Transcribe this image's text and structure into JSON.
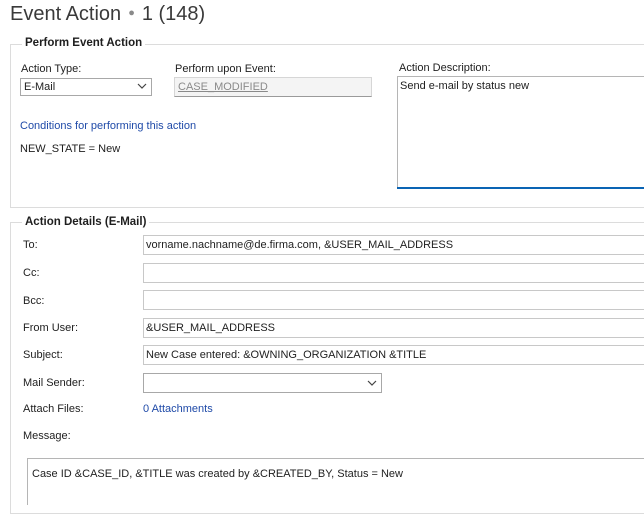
{
  "header": {
    "title": "Event Action",
    "record_id": "1 (148)"
  },
  "perform_group": {
    "legend": "Perform Event Action",
    "action_type_label": "Action Type:",
    "action_type_value": "E-Mail",
    "perform_upon_label": "Perform upon Event:",
    "perform_upon_value": "CASE_MODIFIED",
    "conditions_link": "Conditions for performing this action",
    "condition_text": "NEW_STATE = New",
    "description_label": "Action Description:",
    "description_value": "Send e-mail by status new"
  },
  "details_group": {
    "legend": "Action Details (E-Mail)",
    "to_label": "To:",
    "to_value": "vorname.nachname@de.firma.com, &USER_MAIL_ADDRESS",
    "cc_label": "Cc:",
    "cc_value": "",
    "bcc_label": "Bcc:",
    "bcc_value": "",
    "from_label": "From User:",
    "from_value": "&USER_MAIL_ADDRESS",
    "subject_label": "Subject:",
    "subject_value": "New Case entered: &OWNING_ORGANIZATION &TITLE",
    "sender_label": "Mail Sender:",
    "sender_value": "",
    "attach_label": "Attach Files:",
    "attach_link": "0 Attachments",
    "message_label": "Message:",
    "message_value": "Case ID &CASE_ID, &TITLE was created by &CREATED_BY, Status = New"
  },
  "colors": {
    "link": "#1f4aa8",
    "accent": "#0a64b4",
    "border": "#dcdcdc"
  },
  "icons": {
    "dropdown": "chevron-down-icon"
  }
}
